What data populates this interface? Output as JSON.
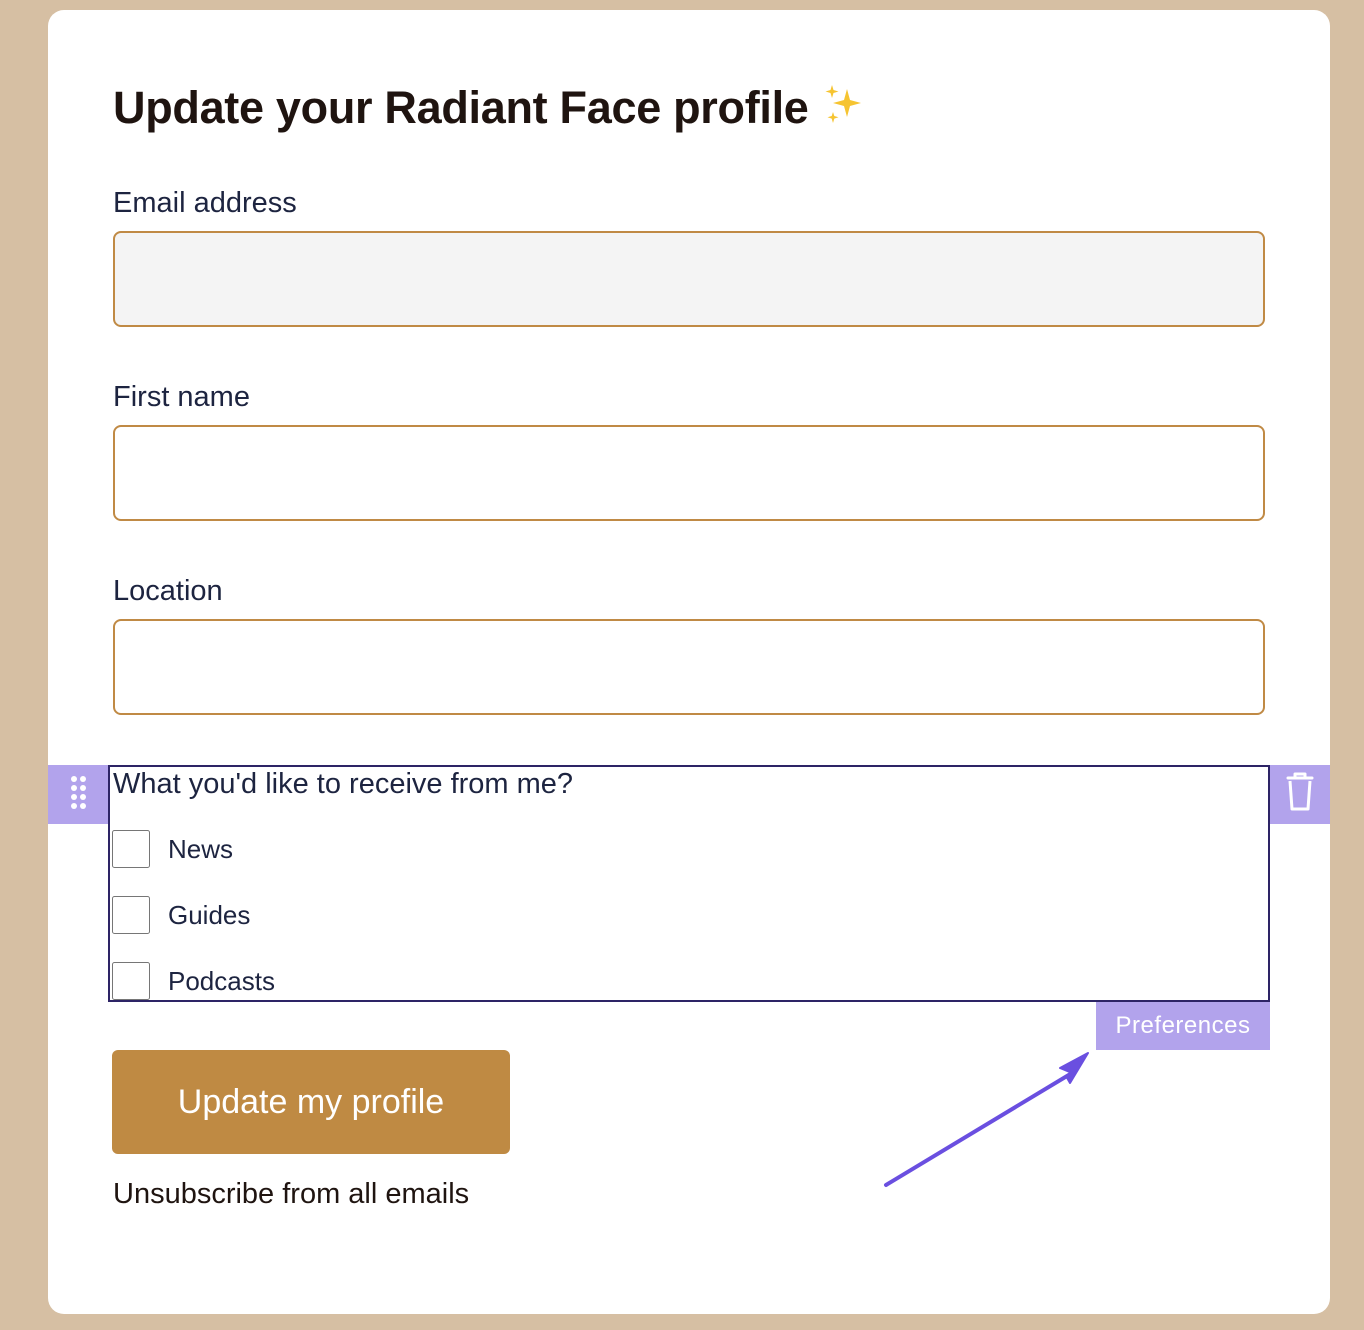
{
  "form": {
    "title": "Update your Radiant Face profile",
    "email_label": "Email address",
    "email_value": "",
    "first_name_label": "First name",
    "first_name_value": "",
    "location_label": "Location",
    "location_value": "",
    "preferences": {
      "question": "What you'd like to receive from me?",
      "options": [
        {
          "label": "News",
          "checked": false
        },
        {
          "label": "Guides",
          "checked": false
        },
        {
          "label": "Podcasts",
          "checked": false
        }
      ],
      "block_tag": "Preferences"
    },
    "submit_label": "Update my profile",
    "unsubscribe_label": "Unsubscribe from all emails"
  },
  "colors": {
    "page_background": "#d6bfa3",
    "input_border": "#c08a45",
    "button_background": "#bf8a43",
    "editor_accent": "#b2a3ec",
    "selection_border": "#2d2466",
    "annotation_arrow": "#6a4fe0"
  },
  "icons": {
    "title_emoji": "sparkles-icon",
    "left_handle": "drag-handle-icon",
    "right_handle": "trash-icon",
    "annotation": "arrow-icon"
  }
}
